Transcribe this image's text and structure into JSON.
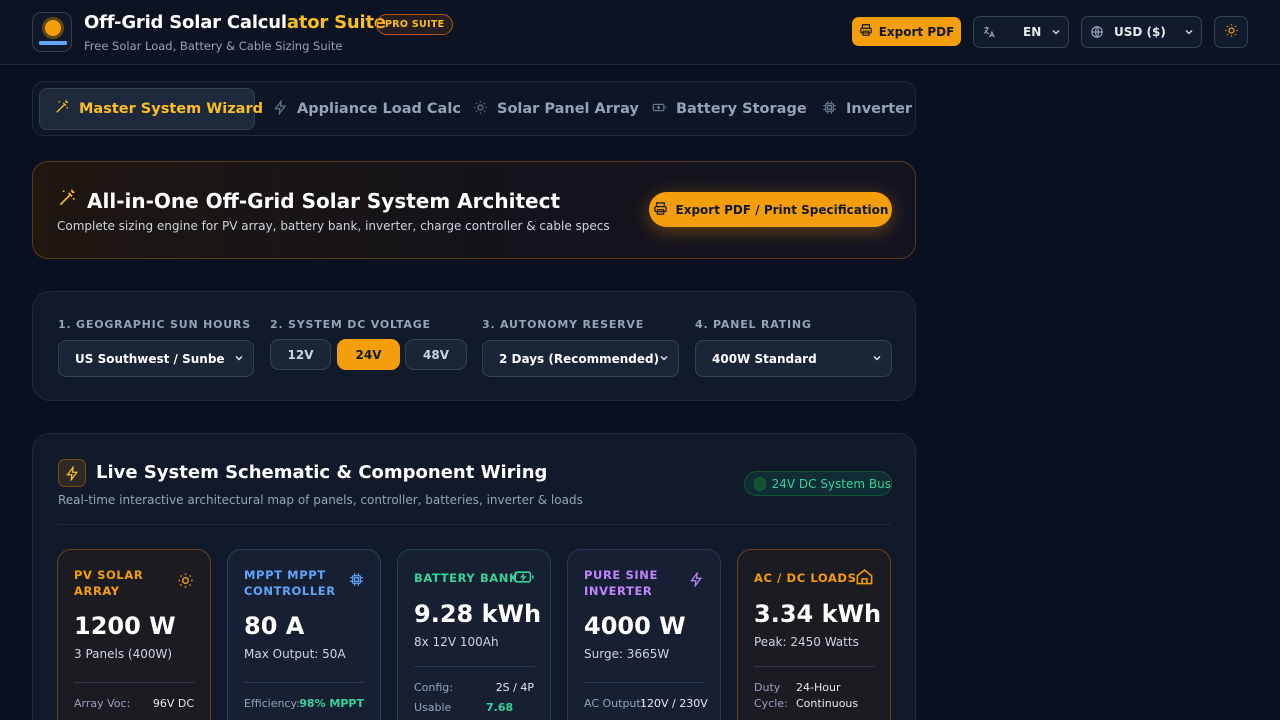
{
  "app": {
    "title_main": "Off-Grid Solar Calcul",
    "title_accent": "ator Suite",
    "badge": "PRO SUITE",
    "subtitle": "Free Solar Load, Battery & Cable Sizing Suite"
  },
  "header": {
    "export_label": "Export PDF",
    "language": "EN",
    "currency": "USD ($)"
  },
  "tabs": [
    {
      "label": "Master System Wizard",
      "icon": "magic-wand-icon",
      "active": true
    },
    {
      "label": "Appliance Load Calc",
      "icon": "lightning-icon",
      "active": false
    },
    {
      "label": "Solar Panel Array",
      "icon": "sun-icon",
      "active": false
    },
    {
      "label": "Battery Storage",
      "icon": "battery-icon",
      "active": false
    },
    {
      "label": "Inverter &",
      "icon": "chip-icon",
      "active": false
    }
  ],
  "hero": {
    "title": "All-in-One Off-Grid Solar System Architect",
    "subtitle": "Complete sizing engine for PV array, battery bank, inverter, charge controller & cable specs",
    "button": "Export PDF / Print Specification"
  },
  "config": {
    "sun_label": "1. GEOGRAPHIC SUN HOURS",
    "sun_value": "US Southwest / Sunbelt (A",
    "voltage_label": "2. SYSTEM DC VOLTAGE",
    "voltages": [
      "12V",
      "24V",
      "48V"
    ],
    "voltage_selected": "24V",
    "autonomy_label": "3. AUTONOMY RESERVE",
    "autonomy_value": "2 Days (Recommended)",
    "panel_label": "4. PANEL RATING",
    "panel_value": "400W Standard"
  },
  "schematic": {
    "title": "Live System Schematic & Component Wiring",
    "subtitle": "Real-time interactive architectural map of panels, controller, batteries, inverter & loads",
    "bus_badge": "24V DC System Bus"
  },
  "cards": {
    "pv": {
      "label": "PV SOLAR ARRAY",
      "value": "1200 W",
      "sub": "3 Panels (400W)",
      "row1_label": "Array Voc:",
      "row1_value": "96V DC",
      "color": "#f59e0b"
    },
    "mppt": {
      "label": "MPPT MPPT CONTROLLER",
      "value": "80 A",
      "sub": "Max Output: 50A",
      "row1_label": "Efficiency:",
      "row1_value": "98% MPPT",
      "color": "#60a5fa"
    },
    "battery": {
      "label": "BATTERY BANK",
      "value": "9.28 kWh",
      "sub": "8x 12V 100Ah",
      "row1_label": "Config:",
      "row1_value": "2S / 4P",
      "row2_label": "Usable",
      "row2_value": "7.68",
      "color": "#34d399"
    },
    "inverter": {
      "label": "PURE SINE INVERTER",
      "value": "4000 W",
      "sub": "Surge: 3665W",
      "row1_label": "AC Output:",
      "row1_value": "120V / 230V",
      "color": "#c084fc"
    },
    "loads": {
      "label": "AC / DC LOADS",
      "value": "3.34 kWh",
      "sub": "Peak: 2450 Watts",
      "row1_label": "Duty",
      "row1_label2": "Cycle:",
      "row1_value": "24-Hour",
      "row1_value2": "Continuous",
      "color": "#f59e0b"
    }
  }
}
